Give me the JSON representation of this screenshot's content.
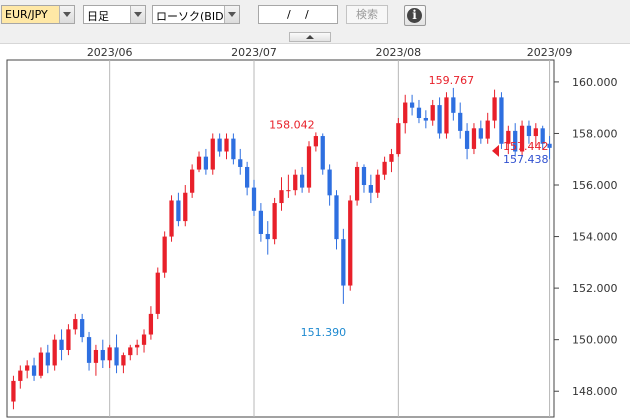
{
  "toolbar": {
    "pair": "EUR/JPY",
    "timeframe": "日足",
    "chart_type": "ローソク(BID)",
    "date_slash1": "/",
    "date_slash2": "/",
    "search_label": "検索",
    "info_label": "i"
  },
  "colors": {
    "up": "#e8202a",
    "down": "#2e6fe0",
    "bid_label": "#e8202a",
    "ask_label": "#3050d0",
    "low_label": "#1f8ad0"
  },
  "chart_data": {
    "type": "candlestick",
    "title": "",
    "ylim": [
      147.0,
      160.85
    ],
    "y_ticks": [
      "160.000",
      "158.000",
      "156.000",
      "154.000",
      "152.000",
      "150.000",
      "148.000"
    ],
    "y_tick_values": [
      160,
      158,
      156,
      154,
      152,
      150,
      148
    ],
    "month_labels": [
      "2023/06",
      "2023/07",
      "2023/08",
      "2023/09"
    ],
    "month_label_index": [
      14,
      35,
      56,
      78
    ],
    "grid": "vertical month lines",
    "annotations": {
      "high_1": "158.042",
      "high_2": "159.767",
      "low_1": "151.390",
      "last_bid": "157.442",
      "last_ask": "157.438"
    },
    "candles": [
      [
        147.6,
        148.6,
        147.3,
        148.4
      ],
      [
        148.4,
        149.0,
        148.1,
        148.8
      ],
      [
        148.8,
        149.2,
        148.5,
        149.0
      ],
      [
        149.0,
        149.3,
        148.4,
        148.6
      ],
      [
        148.6,
        149.7,
        148.5,
        149.5
      ],
      [
        149.5,
        149.8,
        148.7,
        149.0
      ],
      [
        149.0,
        150.2,
        148.8,
        150.0
      ],
      [
        150.0,
        150.4,
        149.2,
        149.6
      ],
      [
        149.6,
        150.6,
        149.4,
        150.4
      ],
      [
        150.4,
        151.0,
        150.2,
        150.8
      ],
      [
        150.8,
        151.0,
        149.9,
        150.1
      ],
      [
        150.1,
        150.3,
        148.8,
        149.1
      ],
      [
        149.1,
        149.8,
        148.6,
        149.6
      ],
      [
        149.6,
        150.0,
        148.9,
        149.2
      ],
      [
        149.2,
        149.8,
        148.9,
        149.7
      ],
      [
        149.7,
        150.2,
        148.7,
        149.0
      ],
      [
        149.0,
        149.5,
        148.7,
        149.4
      ],
      [
        149.4,
        149.8,
        149.2,
        149.7
      ],
      [
        149.7,
        150.0,
        149.4,
        149.8
      ],
      [
        149.8,
        150.4,
        149.5,
        150.2
      ],
      [
        150.2,
        151.3,
        150.0,
        151.0
      ],
      [
        151.0,
        152.8,
        150.8,
        152.6
      ],
      [
        152.6,
        154.2,
        152.4,
        154.0
      ],
      [
        154.0,
        155.6,
        153.8,
        155.4
      ],
      [
        155.4,
        155.7,
        154.4,
        154.6
      ],
      [
        154.6,
        156.0,
        154.4,
        155.7
      ],
      [
        155.7,
        156.8,
        155.5,
        156.6
      ],
      [
        156.6,
        157.3,
        156.5,
        157.1
      ],
      [
        157.1,
        157.4,
        156.4,
        156.6
      ],
      [
        156.6,
        158.0,
        156.4,
        157.8
      ],
      [
        157.8,
        158.0,
        157.1,
        157.3
      ],
      [
        157.3,
        158.0,
        157.0,
        157.8
      ],
      [
        157.8,
        158.0,
        156.8,
        157.0
      ],
      [
        157.0,
        157.4,
        156.4,
        156.7
      ],
      [
        156.7,
        156.9,
        155.6,
        155.9
      ],
      [
        155.9,
        156.2,
        154.8,
        155.0
      ],
      [
        155.0,
        155.3,
        153.8,
        154.1
      ],
      [
        154.1,
        154.6,
        153.3,
        153.9
      ],
      [
        153.9,
        155.5,
        153.7,
        155.3
      ],
      [
        155.3,
        156.3,
        155.0,
        155.8
      ],
      [
        155.8,
        156.4,
        155.5,
        155.8
      ],
      [
        155.8,
        156.6,
        155.6,
        156.4
      ],
      [
        156.4,
        156.7,
        155.7,
        155.9
      ],
      [
        155.9,
        157.7,
        155.7,
        157.5
      ],
      [
        157.5,
        158.042,
        157.3,
        157.9
      ],
      [
        157.9,
        158.0,
        156.4,
        156.6
      ],
      [
        156.6,
        156.8,
        155.2,
        155.6
      ],
      [
        155.6,
        155.8,
        153.5,
        153.9
      ],
      [
        153.9,
        154.3,
        151.39,
        152.1
      ],
      [
        152.1,
        155.6,
        151.9,
        155.4
      ],
      [
        155.4,
        156.9,
        155.2,
        156.7
      ],
      [
        156.7,
        156.8,
        155.7,
        156.0
      ],
      [
        156.0,
        156.4,
        155.3,
        155.7
      ],
      [
        155.7,
        156.6,
        155.5,
        156.4
      ],
      [
        156.4,
        157.1,
        156.2,
        156.9
      ],
      [
        156.9,
        157.4,
        156.5,
        157.2
      ],
      [
        157.2,
        158.6,
        157.1,
        158.4
      ],
      [
        158.4,
        159.5,
        158.0,
        159.2
      ],
      [
        159.2,
        159.5,
        158.7,
        159.0
      ],
      [
        159.0,
        159.3,
        158.4,
        158.6
      ],
      [
        158.6,
        158.9,
        158.2,
        158.5
      ],
      [
        158.5,
        159.3,
        158.3,
        159.1
      ],
      [
        159.1,
        159.4,
        157.8,
        158.0
      ],
      [
        158.0,
        159.6,
        157.8,
        159.4
      ],
      [
        159.4,
        159.767,
        158.5,
        158.8
      ],
      [
        158.8,
        159.2,
        157.8,
        158.1
      ],
      [
        158.1,
        158.4,
        157.0,
        157.4
      ],
      [
        157.4,
        158.4,
        157.2,
        158.2
      ],
      [
        158.2,
        158.5,
        157.6,
        157.8
      ],
      [
        157.8,
        158.8,
        157.6,
        158.5
      ],
      [
        158.5,
        159.7,
        158.2,
        159.4
      ],
      [
        159.4,
        159.6,
        157.4,
        157.6
      ],
      [
        157.6,
        158.3,
        157.2,
        158.1
      ],
      [
        158.1,
        158.4,
        157.1,
        157.3
      ],
      [
        157.3,
        158.5,
        157.1,
        158.3
      ],
      [
        158.3,
        158.5,
        157.6,
        157.9
      ],
      [
        157.9,
        158.4,
        157.5,
        158.2
      ],
      [
        158.2,
        158.3,
        157.4,
        157.6
      ],
      [
        157.6,
        157.9,
        157.0,
        157.442
      ]
    ]
  }
}
